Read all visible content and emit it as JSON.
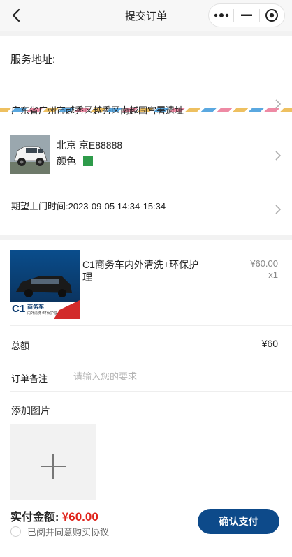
{
  "nav": {
    "title": "提交订单",
    "back_icon": "chevron-left-icon",
    "menu_icon": "more-dots-icon",
    "minimize_icon": "minus-icon",
    "close_icon": "target-circle-icon"
  },
  "address": {
    "label": "服务地址:",
    "text": "广东省广州市越秀区越秀区南越国宫署遗址"
  },
  "car": {
    "plate": "北京 京E88888",
    "color_label": "颜色",
    "color_value": "#2e9b4a"
  },
  "time": {
    "text": "期望上门时间:2023-09-05 14:34-15:34"
  },
  "product": {
    "image_text": "C1",
    "image_subtitle": "商务车",
    "image_tagline": "内外清洗+环保护理",
    "name": "C1商务车内外清洗+环保护理",
    "price": "¥60.00",
    "quantity": "x1"
  },
  "summary": {
    "total_label": "总额",
    "total_value": "¥60"
  },
  "remark": {
    "label": "订单备注",
    "placeholder": "请输入您的要求"
  },
  "photos": {
    "label": "添加图片"
  },
  "footer": {
    "pay_label": "实付金额:",
    "pay_amount": "¥60.00",
    "agree_text": "已阅并同意购买协议",
    "confirm_label": "确认支付"
  },
  "colors": {
    "accent": "#0d4a8a",
    "price_red": "#e0241b"
  }
}
